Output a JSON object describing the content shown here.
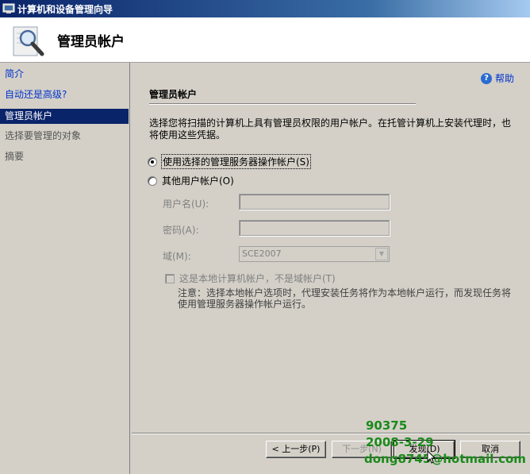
{
  "window": {
    "title": "计算机和设备管理向导"
  },
  "header": {
    "title": "管理员帐户"
  },
  "nav": {
    "items": [
      {
        "label": "简介",
        "state": "link"
      },
      {
        "label": "自动还是高级?",
        "state": "link"
      },
      {
        "label": "管理员帐户",
        "state": "active"
      },
      {
        "label": "选择要管理的对象",
        "state": "disabled"
      },
      {
        "label": "摘要",
        "state": "disabled"
      }
    ]
  },
  "content": {
    "help_label": "帮助",
    "section_title": "管理员帐户",
    "description": "选择您将扫描的计算机上具有管理员权限的用户帐户。在托管计算机上安装代理时，也将使用这些凭据。",
    "radio_use_action_account": "使用选择的管理服务器操作帐户(S)",
    "radio_other_account": "其他用户帐户(O)",
    "username_label": "用户名(U):",
    "username_value": "",
    "password_label": "密码(A):",
    "password_value": "",
    "domain_label": "域(M):",
    "domain_value": "SCE2007",
    "local_account_checkbox": "这是本地计算机帐户，不是域帐户(T)",
    "note": "注意：选择本地帐户选项时，代理安装任务将作为本地帐户运行，而发现任务将使用管理服务器操作帐户运行。"
  },
  "buttons": {
    "back": "< 上一步(P)",
    "next": "下一步(N)",
    "discover": "发现(D)",
    "cancel": "取消"
  },
  "watermark": {
    "line1": "90375",
    "line2": "2008-3-29",
    "line3": "dong8745@hotmail.com"
  }
}
